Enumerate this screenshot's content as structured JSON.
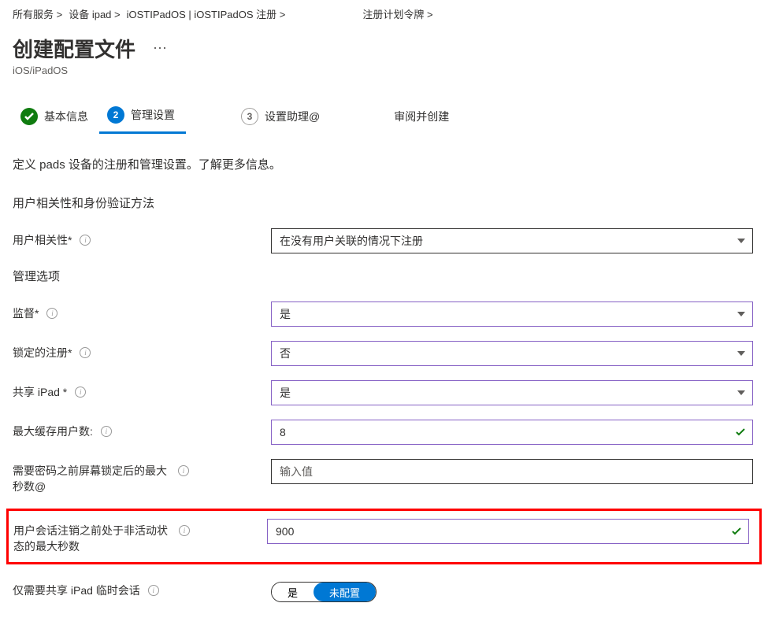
{
  "breadcrumb": {
    "items": [
      "所有服务 >",
      "设备 ipad >",
      "iOSTIPadOS | iOSTIPadOS 注册 >",
      "注册计划令牌 >"
    ]
  },
  "header": {
    "title": "创建配置文件",
    "subtitle": "iOS/iPadOS"
  },
  "steps": {
    "items": [
      {
        "label": "基本信息",
        "state": "done"
      },
      {
        "label": "管理设置",
        "num": "2",
        "state": "active"
      },
      {
        "label": "设置助理@",
        "num": "3",
        "state": "pending"
      },
      {
        "label": "审阅并创建",
        "state": "pending-noicon"
      }
    ]
  },
  "description": "定义 pads 设备的注册和管理设置。了解更多信息。",
  "sections": {
    "user_affinity_title": "用户相关性和身份验证方法",
    "management_options_title": "管理选项"
  },
  "fields": {
    "user_affinity": {
      "label": "用户相关性*",
      "value": "在没有用户关联的情况下注册"
    },
    "supervised": {
      "label": "监督*",
      "value": "是"
    },
    "locked_enrollment": {
      "label": "锁定的注册*",
      "value": "否"
    },
    "shared_ipad": {
      "label": "共享 iPad *",
      "value": "是"
    },
    "max_cached_users": {
      "label": "最大缓存用户数:",
      "value": "8"
    },
    "max_seconds_lock": {
      "label": "需要密码之前屏幕锁定后的最大秒数@",
      "placeholder": "输入值",
      "value": ""
    },
    "max_inactivity": {
      "label": "用户会话注销之前处于非活动状态的最大秒数",
      "value": "900"
    },
    "temp_session": {
      "label": "仅需要共享 iPad 临时会话",
      "options": [
        "是",
        "未配置"
      ],
      "selected": "未配置"
    }
  }
}
